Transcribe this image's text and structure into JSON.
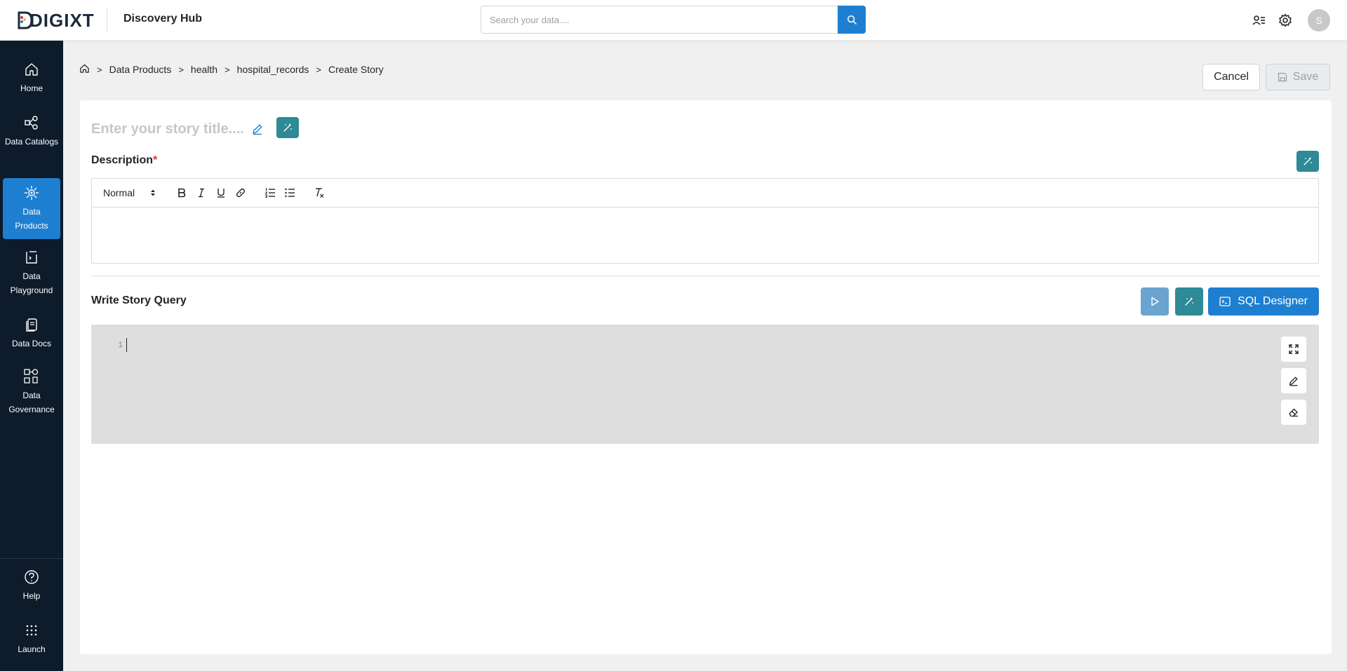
{
  "header": {
    "logo_text": "DIGIXT",
    "app_title": "Discovery Hub",
    "search_placeholder": "Search your data....",
    "avatar_initial": "S"
  },
  "sidebar": {
    "items": [
      {
        "label": "Home",
        "icon": "home-icon"
      },
      {
        "label": "Data Catalogs",
        "icon": "catalog-icon"
      },
      {
        "label": "Data Products",
        "icon": "products-icon",
        "active": true
      },
      {
        "label": "Data Playground",
        "icon": "playground-icon"
      },
      {
        "label": "Data Docs",
        "icon": "docs-icon"
      },
      {
        "label": "Data Governance",
        "icon": "governance-icon"
      }
    ],
    "bottom": [
      {
        "label": "Help",
        "icon": "help-icon"
      },
      {
        "label": "Launch",
        "icon": "launch-grid-icon"
      }
    ]
  },
  "breadcrumb": {
    "items": [
      "Data Products",
      "health",
      "hospital_records",
      "Create Story"
    ],
    "separator": ">"
  },
  "actions": {
    "cancel_label": "Cancel",
    "save_label": "Save"
  },
  "story": {
    "title_placeholder": "Enter your story title....",
    "description_label": "Description",
    "required_marker": "*",
    "toolbar": {
      "format_value": "Normal"
    },
    "query_label": "Write Story Query",
    "sql_designer_label": "SQL Designer",
    "line_number": "1"
  },
  "colors": {
    "primary": "#1e7fd0",
    "teal": "#2d8a96",
    "sidebar_bg": "#0d1b2a",
    "required": "#e03131"
  }
}
